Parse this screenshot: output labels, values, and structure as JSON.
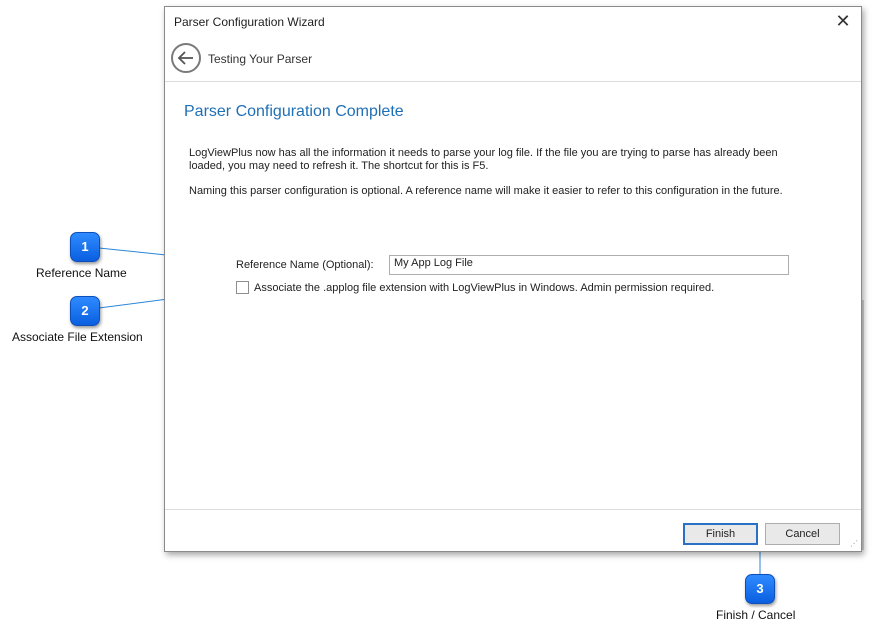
{
  "dialog": {
    "title": "Parser Configuration Wizard",
    "close_glyph": "✕",
    "step_title": "Testing Your Parser",
    "heading": "Parser Configuration Complete",
    "paragraph1_line1": "LogViewPlus now has all the information it needs to parse your log file.  If the file you are trying to parse has already been",
    "paragraph1_line2": "loaded, you may need to refresh it.  The shortcut for this is F5.",
    "paragraph2": "Naming this parser configuration is optional.  A reference name will make it easier to refer to this configuration in the future.",
    "reference_label": "Reference Name (Optional):",
    "reference_value": "My App Log File",
    "associate_label": "Associate the .applog file extension with LogViewPlus in Windows.  Admin permission required.",
    "associate_checked": false,
    "finish_label": "Finish",
    "cancel_label": "Cancel"
  },
  "callouts": [
    {
      "number": "1",
      "label": "Reference Name"
    },
    {
      "number": "2",
      "label": "Associate File Extension"
    },
    {
      "number": "3",
      "label": "Finish / Cancel"
    }
  ],
  "colors": {
    "accent": "#1f6fb5",
    "badge": "#1a73f0",
    "callout_line": "#2a86d8"
  }
}
